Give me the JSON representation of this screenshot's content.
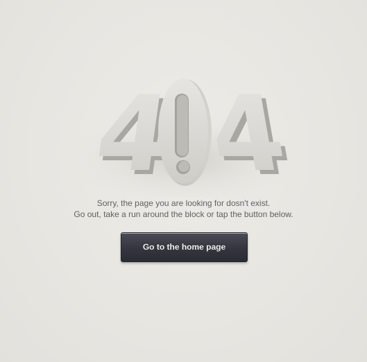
{
  "error": {
    "code_digits": [
      "4",
      "0",
      "4"
    ],
    "message_line_1": "Sorry, the page you are looking for dosn't exist.",
    "message_line_2": "Go out, take a run around the block or tap the button below."
  },
  "actions": {
    "home_button_label": "Go to the home page"
  },
  "colors": {
    "background": "#e8e6e1",
    "digit_face": "#dcdbd6",
    "button": "#34353e",
    "button_text": "#f2f2f2",
    "message_text": "#5f5f5f"
  }
}
